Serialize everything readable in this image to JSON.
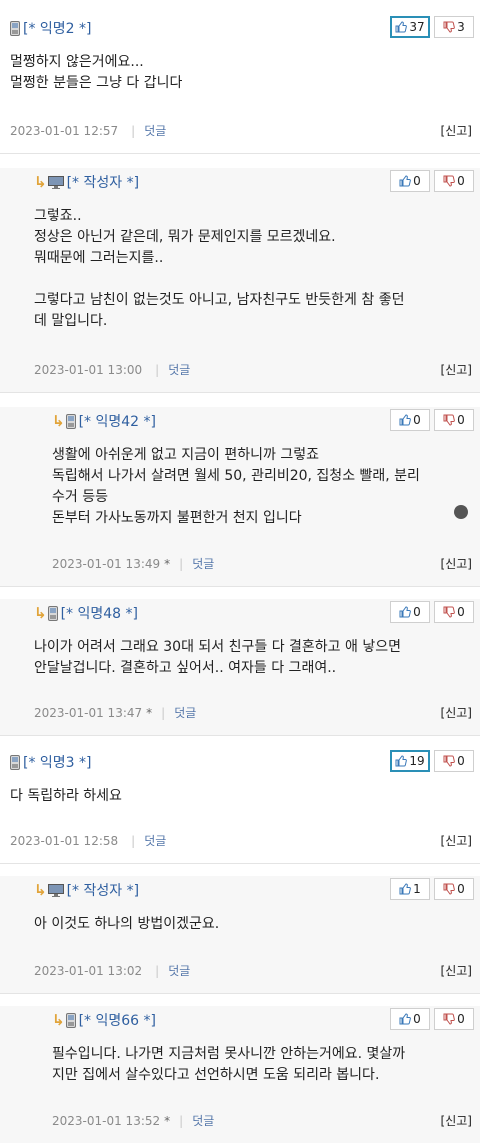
{
  "comments": [
    {
      "author": "[* 익명2 *]",
      "body": "멀쩡하지 않은거에요...\n멀쩡한 분들은 그냥 다 갑니다",
      "time": "2023-01-01 12:57",
      "star": "",
      "reply_label": "덧글",
      "report_label": "[신고]",
      "up": "37",
      "down": "3",
      "is_reply": false,
      "up_hot": true,
      "device": "phone-icon"
    },
    {
      "author": "[* 작성자 *]",
      "body": "그렇죠..\n정상은 아닌거 같은데, 뭐가 문제인지를 모르겠네요.\n뭐때문에 그러는지를..\n\n그렇다고 남친이 없는것도 아니고, 남자친구도 반듯한게 참 좋던\n데 말입니다.",
      "time": "2023-01-01 13:00",
      "star": "",
      "reply_label": "덧글",
      "report_label": "[신고]",
      "up": "0",
      "down": "0",
      "is_reply": true,
      "up_hot": false,
      "device": "monitor-icon"
    },
    {
      "author": "[* 익명42 *]",
      "body": "생활에 아쉬운게 없고 지금이 편하니까 그렇죠\n독립해서 나가서 살려면 월세 50, 관리비20, 집청소 빨래, 분리\n수거 등등\n돈부터 가사노동까지 불편한거 천지 입니다",
      "time": "2023-01-01 13:49",
      "star": "*",
      "reply_label": "덧글",
      "report_label": "[신고]",
      "up": "0",
      "down": "0",
      "is_reply": true,
      "up_hot": false,
      "device": "phone-icon"
    },
    {
      "author": "[* 익명48 *]",
      "body": "나이가 어려서 그래요 30대 되서 친구들 다 결혼하고 애 낳으면\n안달날겁니다. 결혼하고 싶어서.. 여자들 다 그래여..",
      "time": "2023-01-01 13:47",
      "star": "*",
      "reply_label": "덧글",
      "report_label": "[신고]",
      "up": "0",
      "down": "0",
      "is_reply": true,
      "up_hot": false,
      "device": "phone-icon"
    },
    {
      "author": "[* 익명3 *]",
      "body": "다 독립하라 하세요",
      "time": "2023-01-01 12:58",
      "star": "",
      "reply_label": "덧글",
      "report_label": "[신고]",
      "up": "19",
      "down": "0",
      "is_reply": false,
      "up_hot": true,
      "device": "phone-icon"
    },
    {
      "author": "[* 작성자 *]",
      "body": "아 이것도 하나의 방법이겠군요.",
      "time": "2023-01-01 13:02",
      "star": "",
      "reply_label": "덧글",
      "report_label": "[신고]",
      "up": "1",
      "down": "0",
      "is_reply": true,
      "up_hot": false,
      "device": "monitor-icon"
    },
    {
      "author": "[* 익명66 *]",
      "body": "필수입니다. 나가면 지금처럼 못사니깐 안하는거에요. 몇살까\n지만 집에서 살수있다고 선언하시면 도움 되리라 봅니다.",
      "time": "2023-01-01 13:52",
      "star": "*",
      "reply_label": "덧글",
      "report_label": "[신고]",
      "up": "0",
      "down": "0",
      "is_reply": true,
      "up_hot": false,
      "device": "phone-icon"
    }
  ],
  "colors": {
    "author": "#2f5fa0",
    "arrow": "#e1a43a",
    "vote_hot_border": "#2a8fb6",
    "reply_bg": "#f7f7f7"
  }
}
